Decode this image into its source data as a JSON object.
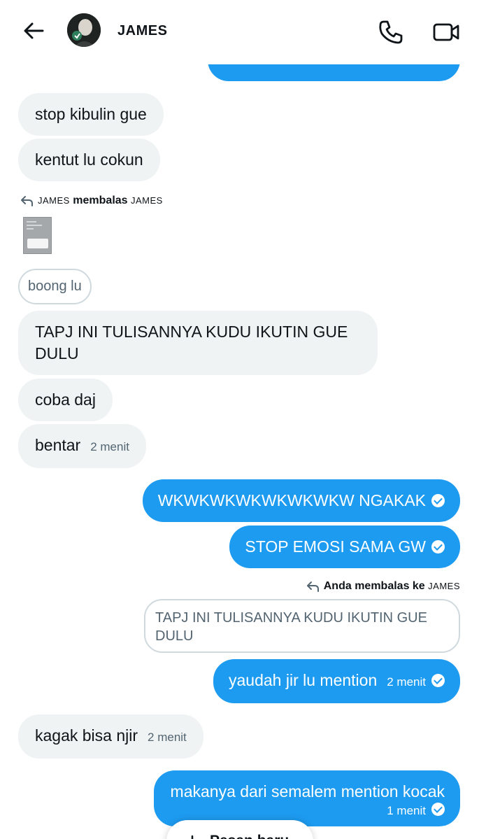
{
  "header": {
    "name": "JAMES"
  },
  "messages": {
    "m1": "stop kibulin gue",
    "m2": "kentut lu cokun",
    "reply1": {
      "sender": "JAMES",
      "verb": "membalas",
      "target": "JAMES"
    },
    "m3": "boong lu",
    "m4": "TAPJ INI TULISANNYA KUDU IKUTIN GUE DULU",
    "m5": "coba daj",
    "m6": {
      "text": "bentar",
      "time": "2 menit"
    },
    "m7": "WKWKWKWKWKWKWKW NGAKAK",
    "m8": "STOP EMOSI SAMA GW",
    "reply2": {
      "label": "Anda membalas ke",
      "target": "JAMES"
    },
    "m9": "TAPJ INI TULISANNYA KUDU IKUTIN GUE DULU",
    "m10": {
      "text": "yaudah jir lu mention",
      "time": "2 menit"
    },
    "m11": {
      "text": "kagak bisa njir",
      "time": "2 menit"
    },
    "m12": {
      "text": "makanya dari semalem mention kocak",
      "time": "1 menit"
    }
  },
  "new_message": {
    "label": "Pesan baru"
  },
  "icons": {
    "back": "arrow-left-icon",
    "phone": "phone-icon",
    "video": "video-camera-icon",
    "reply": "reply-arrow-icon",
    "check": "check-circle-icon",
    "plus": "plus-icon"
  },
  "colors": {
    "outgoing": "#1d9bf0",
    "incoming": "#eff3f4",
    "secondary_text": "#536471"
  }
}
